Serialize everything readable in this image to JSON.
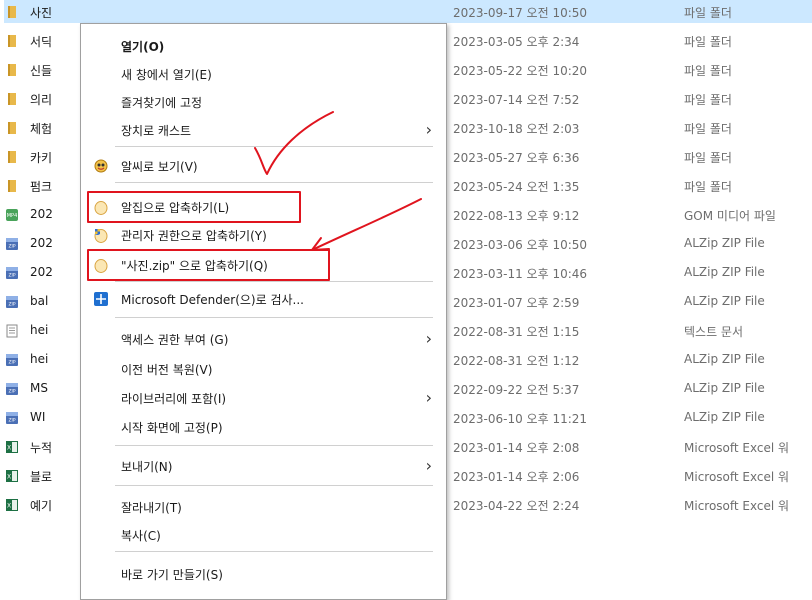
{
  "files": [
    {
      "name": "사진",
      "date": "2023-09-17 오전 10:50",
      "type": "파일 폴더",
      "icon": "folder-icon",
      "selected": true
    },
    {
      "name": "서딕",
      "date": "2023-03-05 오후 2:34",
      "type": "파일 폴더",
      "icon": "folder-icon"
    },
    {
      "name": "신들",
      "date": "2023-05-22 오전 10:20",
      "type": "파일 폴더",
      "icon": "folder-icon"
    },
    {
      "name": "의리",
      "date": "2023-07-14 오전 7:52",
      "type": "파일 폴더",
      "icon": "folder-icon"
    },
    {
      "name": "체험",
      "date": "2023-10-18 오전 2:03",
      "type": "파일 폴더",
      "icon": "folder-icon"
    },
    {
      "name": "카키",
      "date": "2023-05-27 오후 6:36",
      "type": "파일 폴더",
      "icon": "folder-icon"
    },
    {
      "name": "펌크",
      "date": "2023-05-24 오전 1:35",
      "type": "파일 폴더",
      "icon": "folder-icon"
    },
    {
      "name": "202",
      "date": "2022-08-13 오후 9:12",
      "type": "GOM 미디어 파일",
      "icon": "media-file-icon"
    },
    {
      "name": "202",
      "date": "2023-03-06 오후 10:50",
      "type": "ALZip ZIP File",
      "icon": "zip-file-icon"
    },
    {
      "name": "202",
      "date": "2023-03-11 오후 10:46",
      "type": "ALZip ZIP File",
      "icon": "zip-file-icon"
    },
    {
      "name": "bal",
      "date": "2023-01-07 오후 2:59",
      "type": "ALZip ZIP File",
      "icon": "zip-file-icon"
    },
    {
      "name": "hei",
      "date": "2022-08-31 오전 1:15",
      "type": "텍스트 문서",
      "icon": "text-file-icon"
    },
    {
      "name": "hei",
      "date": "2022-08-31 오전 1:12",
      "type": "ALZip ZIP File",
      "icon": "zip-file-icon"
    },
    {
      "name": "MS",
      "date": "2022-09-22 오전 5:37",
      "type": "ALZip ZIP File",
      "icon": "zip-file-icon"
    },
    {
      "name": "WI",
      "date": "2023-06-10 오후 11:21",
      "type": "ALZip ZIP File",
      "icon": "zip-file-icon"
    },
    {
      "name": "누적",
      "date": "2023-01-14 오후 2:08",
      "type": "Microsoft Excel 워",
      "icon": "excel-file-icon"
    },
    {
      "name": "블로",
      "date": "2023-01-14 오후 2:06",
      "type": "Microsoft Excel 워",
      "icon": "excel-file-icon"
    },
    {
      "name": "예기",
      "date": "2023-04-22 오전 2:24",
      "type": "Microsoft Excel 워",
      "icon": "excel-file-icon"
    }
  ],
  "context_menu": {
    "open": "열기(O)",
    "open_new_window": "새 창에서 열기(E)",
    "pin_quick_access": "즐겨찾기에 고정",
    "cast_to_device": "장치로 캐스트",
    "alsee_view": "알씨로 보기(V)",
    "alzip_compress": "알집으로 압축하기(L)",
    "admin_compress": "관리자 권한으로 압축하기(Y)",
    "compress_to_zip": "\"사진.zip\" 으로 압축하기(Q)",
    "defender_scan": "Microsoft Defender(으)로 검사...",
    "give_access": "액세스 권한 부여 (G)",
    "restore_previous": "이전 버전 복원(V)",
    "include_library": "라이브러리에 포함(I)",
    "pin_start": "시작 화면에 고정(P)",
    "send_to": "보내기(N)",
    "cut": "잘라내기(T)",
    "copy": "복사(C)",
    "create_shortcut": "바로 가기 만들기(S)"
  },
  "colors": {
    "selection": "#cce8ff",
    "annotation_red": "#e0141e",
    "folder": "#e8b84a"
  }
}
